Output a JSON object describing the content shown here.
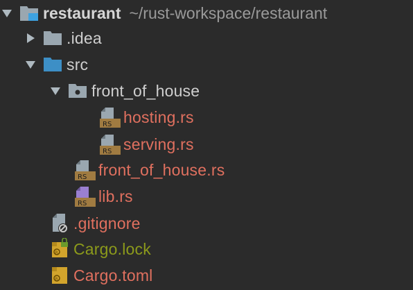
{
  "colors": {
    "background": "#2b2b2b",
    "default_text": "#cfcfcf",
    "modified_text": "#e0705f",
    "added_text": "#8c9a1b",
    "folder_gray": "#9aa7b0",
    "folder_blue": "#3d8fc6",
    "rs_badge": "#a07b41"
  },
  "project": {
    "name": "restaurant",
    "path": "~/rust-workspace/restaurant",
    "icon": "project-folder-icon"
  },
  "items": [
    {
      "label": ".idea",
      "icon": "folder-icon",
      "expander": "collapsed",
      "status": "default"
    },
    {
      "label": "src",
      "icon": "source-folder-icon",
      "expander": "expanded",
      "status": "default"
    },
    {
      "label": "front_of_house",
      "icon": "package-folder-icon",
      "expander": "expanded",
      "status": "default"
    },
    {
      "label": "hosting.rs",
      "icon": "rust-file-icon",
      "status": "modified"
    },
    {
      "label": "serving.rs",
      "icon": "rust-file-icon",
      "status": "modified"
    },
    {
      "label": "front_of_house.rs",
      "icon": "rust-file-icon",
      "status": "modified"
    },
    {
      "label": "lib.rs",
      "icon": "rust-lib-file-icon",
      "status": "modified"
    },
    {
      "label": ".gitignore",
      "icon": "ignored-file-icon",
      "status": "modified"
    },
    {
      "label": "Cargo.lock",
      "icon": "cargo-lock-icon",
      "status": "added"
    },
    {
      "label": "Cargo.toml",
      "icon": "cargo-toml-icon",
      "status": "modified"
    }
  ],
  "badges": {
    "rs": "RS"
  }
}
